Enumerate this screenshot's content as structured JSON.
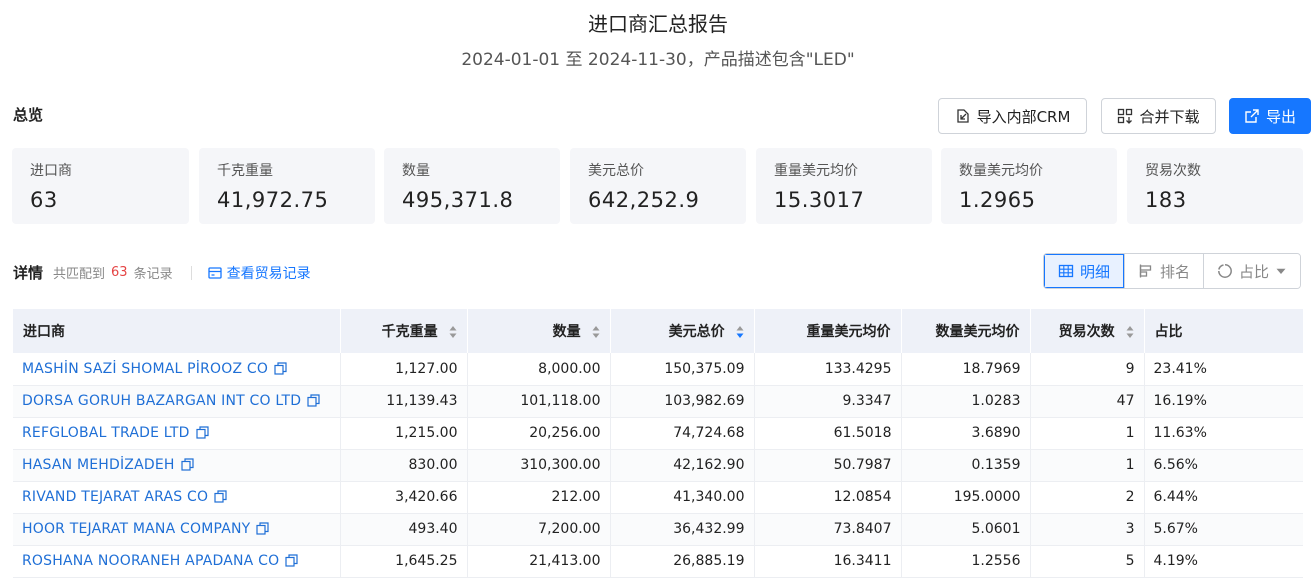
{
  "header": {
    "title": "进口商汇总报告",
    "subtitle": "2024-01-01 至 2024-11-30，产品描述包含\"LED\""
  },
  "overview": {
    "label": "总览",
    "buttons": {
      "import_crm": "导入内部CRM",
      "merge_download": "合并下载",
      "export": "导出"
    },
    "stats": [
      {
        "label": "进口商",
        "value": "63"
      },
      {
        "label": "千克重量",
        "value": "41,972.75"
      },
      {
        "label": "数量",
        "value": "495,371.8"
      },
      {
        "label": "美元总价",
        "value": "642,252.9"
      },
      {
        "label": "重量美元均价",
        "value": "15.3017"
      },
      {
        "label": "数量美元均价",
        "value": "1.2965"
      },
      {
        "label": "贸易次数",
        "value": "183"
      }
    ]
  },
  "details": {
    "title": "详情",
    "count_prefix": "共匹配到",
    "count": "63",
    "count_suffix": "条记录",
    "view_trade_link": "查看贸易记录",
    "view_modes": {
      "detail": "明细",
      "ranking": "排名",
      "share": "占比"
    }
  },
  "table": {
    "columns": [
      "进口商",
      "千克重量",
      "数量",
      "美元总价",
      "重量美元均价",
      "数量美元均价",
      "贸易次数",
      "占比"
    ],
    "rows": [
      [
        "MASHİN SAZİ SHOMAL PİROOZ CO",
        "1,127.00",
        "8,000.00",
        "150,375.09",
        "133.4295",
        "18.7969",
        "9",
        "23.41%"
      ],
      [
        "DORSA GORUH BAZARGAN INT CO LTD",
        "11,139.43",
        "101,118.00",
        "103,982.69",
        "9.3347",
        "1.0283",
        "47",
        "16.19%"
      ],
      [
        "REFGLOBAL TRADE LTD",
        "1,215.00",
        "20,256.00",
        "74,724.68",
        "61.5018",
        "3.6890",
        "1",
        "11.63%"
      ],
      [
        "HASAN MEHDİZADEH",
        "830.00",
        "310,300.00",
        "42,162.90",
        "50.7987",
        "0.1359",
        "1",
        "6.56%"
      ],
      [
        "RIVAND TEJARAT ARAS CO",
        "3,420.66",
        "212.00",
        "41,340.00",
        "12.0854",
        "195.0000",
        "2",
        "6.44%"
      ],
      [
        "HOOR TEJARAT MANA COMPANY",
        "493.40",
        "7,200.00",
        "36,432.99",
        "73.8407",
        "5.0601",
        "3",
        "5.67%"
      ],
      [
        "ROSHANA NOORANEH APADANA CO",
        "1,645.25",
        "21,413.00",
        "26,885.19",
        "16.3411",
        "1.2556",
        "5",
        "4.19%"
      ]
    ]
  },
  "colors": {
    "primary": "#1677ff",
    "link": "#1f6fd6",
    "count_highlight": "#e54545",
    "card_bg": "#f5f6f9",
    "table_header_bg": "#eef1f8"
  }
}
